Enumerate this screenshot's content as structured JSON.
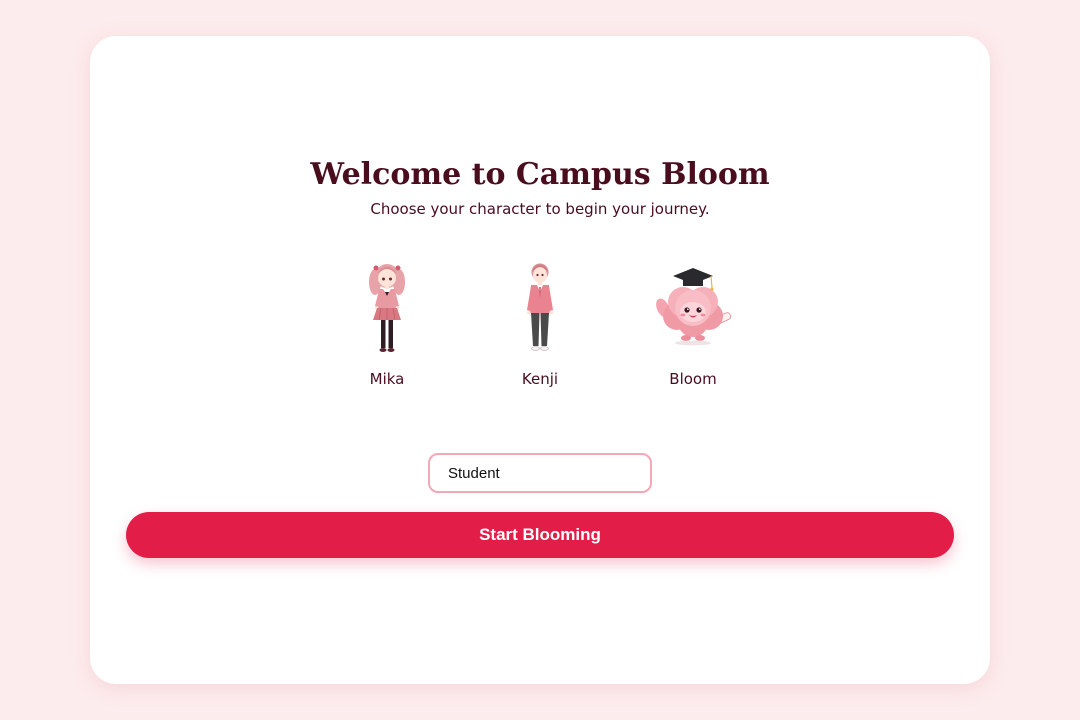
{
  "header": {
    "title": "Welcome to Campus Bloom",
    "subtitle": "Choose your character to begin your journey."
  },
  "characters": [
    {
      "name": "Mika",
      "icon": "girl-student-icon"
    },
    {
      "name": "Kenji",
      "icon": "boy-student-icon"
    },
    {
      "name": "Bloom",
      "icon": "flower-mascot-graduation-icon"
    }
  ],
  "name_input": {
    "value": "Student"
  },
  "start_button": {
    "label": "Start Blooming"
  },
  "colors": {
    "background": "#fdeced",
    "card": "#ffffff",
    "text": "#4a0d1e",
    "accent": "#e11d48",
    "input_border": "#f4a7b4"
  }
}
